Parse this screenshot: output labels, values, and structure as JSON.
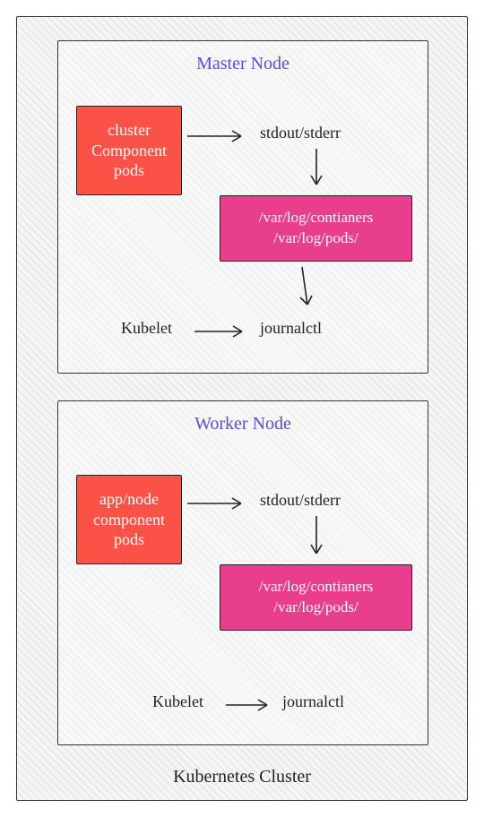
{
  "cluster": {
    "label": "Kubernetes Cluster"
  },
  "master": {
    "title": "Master Node",
    "pod_line1": "cluster",
    "pod_line2": "Component",
    "pod_line3": "pods",
    "stdout": "stdout/stderr",
    "log_line1": "/var/log/contianers",
    "log_line2": "/var/log/pods/",
    "kubelet": "Kubelet",
    "journalctl": "journalctl"
  },
  "worker": {
    "title": "Worker Node",
    "pod_line1": "app/node",
    "pod_line2": "component",
    "pod_line3": "pods",
    "stdout": "stdout/stderr",
    "log_line1": "/var/log/contianers",
    "log_line2": "/var/log/pods/",
    "kubelet": "Kubelet",
    "journalctl": "journalctl"
  }
}
